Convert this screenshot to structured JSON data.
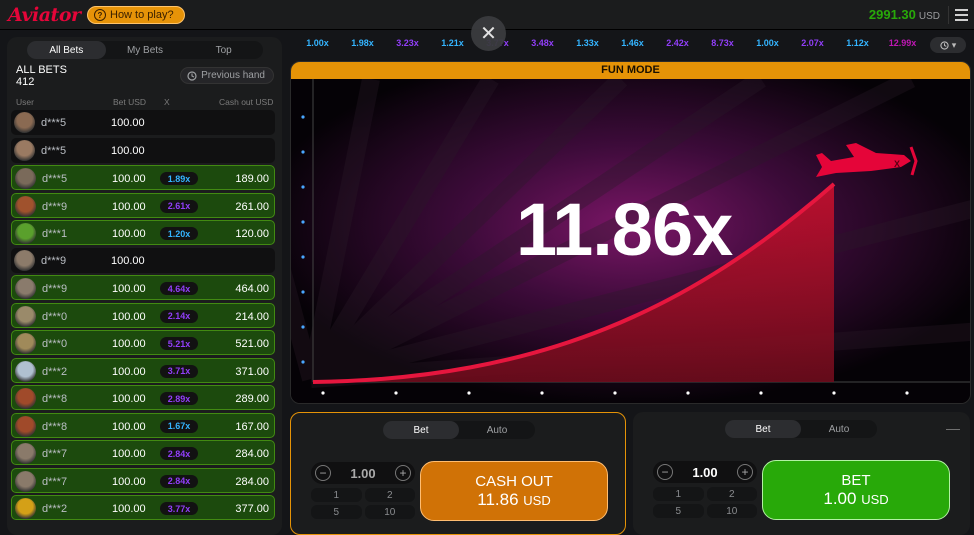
{
  "app": {
    "logo": "Aviator",
    "how_to_play": "How to play?",
    "balance": "2991.30",
    "currency": "USD"
  },
  "bets_panel": {
    "tabs": [
      "All Bets",
      "My Bets",
      "Top"
    ],
    "all_bets_label": "ALL BETS",
    "all_bets_count": "412",
    "previous_hand": "Previous hand",
    "columns": {
      "user": "User",
      "bet": "Bet USD",
      "x": "X",
      "cashout": "Cash out USD"
    },
    "rows": [
      {
        "user": "d***5",
        "bet": "100.00",
        "mult": "",
        "cashout": "",
        "win": false,
        "avatar": "#8a6a52"
      },
      {
        "user": "d***5",
        "bet": "100.00",
        "mult": "",
        "cashout": "",
        "win": false,
        "avatar": "#9a7a62"
      },
      {
        "user": "d***5",
        "bet": "100.00",
        "mult": "1.89x",
        "cashout": "189.00",
        "win": true,
        "mcolor": "#34b4ff",
        "avatar": "#7a6a5a"
      },
      {
        "user": "d***9",
        "bet": "100.00",
        "mult": "2.61x",
        "cashout": "261.00",
        "win": true,
        "mcolor": "#913ef8",
        "avatar": "#a0522d"
      },
      {
        "user": "d***1",
        "bet": "100.00",
        "mult": "1.20x",
        "cashout": "120.00",
        "win": true,
        "mcolor": "#34b4ff",
        "avatar": "#5aa02c"
      },
      {
        "user": "d***9",
        "bet": "100.00",
        "mult": "",
        "cashout": "",
        "win": false,
        "avatar": "#8c7b6a"
      },
      {
        "user": "d***9",
        "bet": "100.00",
        "mult": "4.64x",
        "cashout": "464.00",
        "win": true,
        "mcolor": "#913ef8",
        "avatar": "#8a7b6c"
      },
      {
        "user": "d***0",
        "bet": "100.00",
        "mult": "2.14x",
        "cashout": "214.00",
        "win": true,
        "mcolor": "#913ef8",
        "avatar": "#9a8a6a"
      },
      {
        "user": "d***0",
        "bet": "100.00",
        "mult": "5.21x",
        "cashout": "521.00",
        "win": true,
        "mcolor": "#913ef8",
        "avatar": "#a08a5a"
      },
      {
        "user": "d***2",
        "bet": "100.00",
        "mult": "3.71x",
        "cashout": "371.00",
        "win": true,
        "mcolor": "#913ef8",
        "avatar": "#b0c0d0"
      },
      {
        "user": "d***8",
        "bet": "100.00",
        "mult": "2.89x",
        "cashout": "289.00",
        "win": true,
        "mcolor": "#913ef8",
        "avatar": "#a04a2a"
      },
      {
        "user": "d***8",
        "bet": "100.00",
        "mult": "1.67x",
        "cashout": "167.00",
        "win": true,
        "mcolor": "#34b4ff",
        "avatar": "#a04a2a"
      },
      {
        "user": "d***7",
        "bet": "100.00",
        "mult": "2.84x",
        "cashout": "284.00",
        "win": true,
        "mcolor": "#913ef8",
        "avatar": "#8a7a6a"
      },
      {
        "user": "d***7",
        "bet": "100.00",
        "mult": "2.84x",
        "cashout": "284.00",
        "win": true,
        "mcolor": "#913ef8",
        "avatar": "#8a7a6a"
      },
      {
        "user": "d***2",
        "bet": "100.00",
        "mult": "3.77x",
        "cashout": "377.00",
        "win": true,
        "mcolor": "#913ef8",
        "avatar": "#d4a017"
      }
    ]
  },
  "history": [
    {
      "v": "1.00x",
      "c": "#34b4ff"
    },
    {
      "v": "1.98x",
      "c": "#34b4ff"
    },
    {
      "v": "3.23x",
      "c": "#913ef8"
    },
    {
      "v": "1.21x",
      "c": "#34b4ff"
    },
    {
      "v": "3.77x",
      "c": "#913ef8"
    },
    {
      "v": "3.48x",
      "c": "#913ef8"
    },
    {
      "v": "1.33x",
      "c": "#34b4ff"
    },
    {
      "v": "1.46x",
      "c": "#34b4ff"
    },
    {
      "v": "2.42x",
      "c": "#913ef8"
    },
    {
      "v": "8.73x",
      "c": "#913ef8"
    },
    {
      "v": "1.00x",
      "c": "#34b4ff"
    },
    {
      "v": "2.07x",
      "c": "#913ef8"
    },
    {
      "v": "1.12x",
      "c": "#34b4ff"
    },
    {
      "v": "12.99x",
      "c": "#c017b4"
    }
  ],
  "game": {
    "mode_label": "FUN MODE",
    "multiplier": "11.86x"
  },
  "panel1": {
    "tabs": [
      "Bet",
      "Auto"
    ],
    "amount": "1.00",
    "quick": [
      "1",
      "2",
      "5",
      "10"
    ],
    "btn_line1": "CASH OUT",
    "btn_amount": "11.86",
    "btn_currency": "USD"
  },
  "panel2": {
    "tabs": [
      "Bet",
      "Auto"
    ],
    "amount": "1.00",
    "quick": [
      "1",
      "2",
      "5",
      "10"
    ],
    "btn_line1": "BET",
    "btn_amount": "1.00",
    "btn_currency": "USD"
  }
}
